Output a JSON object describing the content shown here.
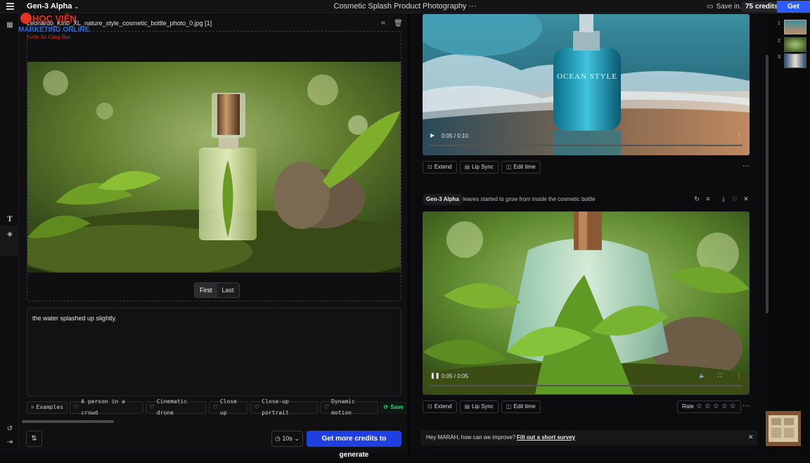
{
  "topbar": {
    "model": "Gen-3 Alpha",
    "title": "Cosmetic Splash Product Photography",
    "title_more": "···",
    "save_in": "Save in...",
    "credits": "75 credits",
    "get_credits": "Get credits"
  },
  "watermark": {
    "line1": "HỌC VIỆN",
    "line2": "MARKETING ONLINE",
    "line3": "Vươn Xa Cùng Bạn"
  },
  "left": {
    "file_name": "Leonardo_Kino_XL_nature_style_cosmetic_bottle_photo_0.jpg [1]",
    "first_label": "First",
    "last_label": "Last",
    "prompt": "the water splashed up slightly.",
    "chips": [
      {
        "label": "Examples",
        "icon": "examples-icon"
      },
      {
        "label": "A person in a crowd",
        "icon": "bulb-icon"
      },
      {
        "label": "Cinematic drone",
        "icon": "bulb-icon"
      },
      {
        "label": "Close up",
        "icon": "bulb-icon"
      },
      {
        "label": "Close-up portrait",
        "icon": "bulb-icon"
      },
      {
        "label": "Dynamic motion",
        "icon": "bulb-icon"
      }
    ],
    "save_label": "Save",
    "duration": "10s",
    "generate_label": "Get more credits to generate"
  },
  "right": {
    "video1": {
      "time": "0:05 / 0:10"
    },
    "actions": {
      "extend": "Extend",
      "lip_sync": "Lip Sync",
      "edit_time": "Edit time"
    },
    "gen_tag": "Gen-3 Alpha",
    "gen_prompt": "leaves started to grow from inside the cosmetic bottle",
    "video2": {
      "time": "0:05 / 0:05"
    },
    "rate_label": "Rate",
    "rating": 0,
    "survey": {
      "question": "Hey MARAH, how can we improve?",
      "link": "Fill out a short survey"
    }
  },
  "thumbs": {
    "numbers": [
      "1",
      "2",
      "3"
    ]
  },
  "colors": {
    "accent": "#2d5bff",
    "generate": "#1f3fe0",
    "save_green": "#2fd07a"
  }
}
